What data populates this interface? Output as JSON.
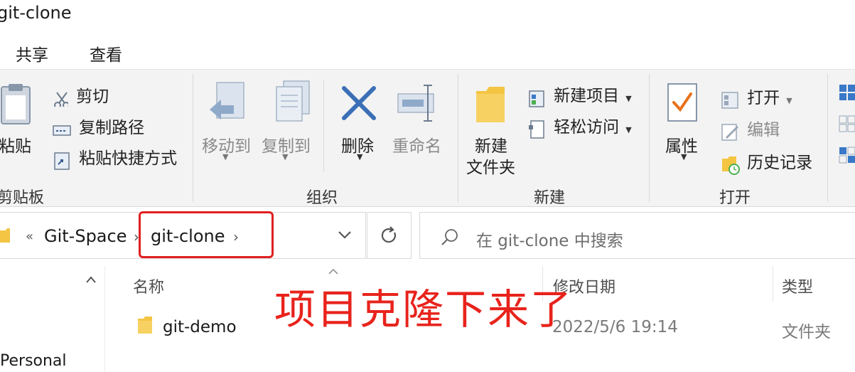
{
  "window": {
    "title": "git-clone"
  },
  "menu": {
    "share": "共享",
    "view": "查看"
  },
  "ribbon": {
    "clipboard": {
      "paste": "粘贴",
      "cut": "剪切",
      "copy_path": "复制路径",
      "paste_shortcut": "粘贴快捷方式",
      "group": "剪贴板"
    },
    "organize": {
      "move_to": "移动到",
      "copy_to": "复制到",
      "delete": "删除",
      "rename": "重命名",
      "group": "组织"
    },
    "new": {
      "new_folder_line1": "新建",
      "new_folder_line2": "文件夹",
      "new_item": "新建项目",
      "easy_access": "轻松访问",
      "group": "新建"
    },
    "open": {
      "properties": "属性",
      "open": "打开",
      "edit": "编辑",
      "history": "历史记录",
      "group": "打开"
    }
  },
  "address": {
    "overflow": "«",
    "crumbs": [
      "Git-Space",
      "git-clone"
    ]
  },
  "search": {
    "placeholder": "在 git-clone 中搜索"
  },
  "columns": {
    "name": "名称",
    "date": "修改日期",
    "type": "类型"
  },
  "files": [
    {
      "name": "git-demo",
      "date": "2022/5/6 19:14",
      "type": "文件夹"
    }
  ],
  "nav": {
    "item": "Personal"
  },
  "annotation": "项目克隆下来了",
  "colors": {
    "annotation": "#e8231c",
    "folder": "#f4c542",
    "delete_x": "#3b6fb6"
  }
}
